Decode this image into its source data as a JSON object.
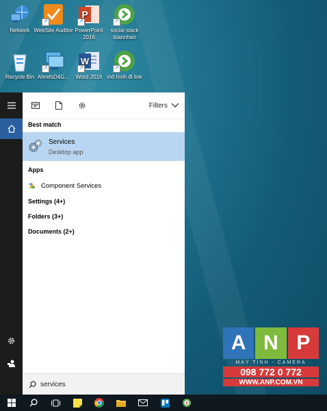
{
  "desktop": {
    "icons": [
      {
        "label": "Network",
        "icon": "network-icon"
      },
      {
        "label": "WebSite Auditor",
        "icon": "website-auditor-icon"
      },
      {
        "label": "PowerPoint 2016",
        "icon": "powerpoint-icon"
      },
      {
        "label": "social stack toannhan",
        "icon": "chrome-bookmark-icon"
      },
      {
        "label": "Recycle Bin",
        "icon": "recycle-bin-icon"
      },
      {
        "label": "AhrefsD4G...",
        "icon": "ahrefs-icon"
      },
      {
        "label": "Word 2016",
        "icon": "word-icon"
      },
      {
        "label": "mô hình đi link",
        "icon": "chrome-bookmark-icon"
      }
    ]
  },
  "start_menu": {
    "filters_label": "Filters",
    "best_match_heading": "Best match",
    "best_match": {
      "title": "Services",
      "subtitle": "Desktop app"
    },
    "apps_heading": "Apps",
    "apps": [
      {
        "label": "Component Services"
      }
    ],
    "settings": "Settings (4+)",
    "folders": "Folders (3+)",
    "documents": "Documents (2+)",
    "search_query": "services"
  },
  "watermark": {
    "letters": [
      "A",
      "N",
      "P"
    ],
    "tagline": "MÁY TÍNH - CAMERA",
    "phone": "098 772 0 772",
    "site": "WWW.ANP.COM.VN"
  }
}
